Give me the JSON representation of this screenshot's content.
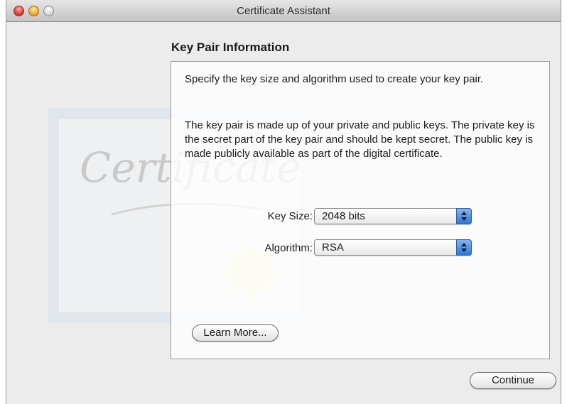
{
  "window": {
    "title": "Certificate Assistant"
  },
  "watermark": {
    "text": "Certificate"
  },
  "page": {
    "heading": "Key Pair Information",
    "description_1": "Specify the key size and algorithm used to create your key pair.",
    "description_2": "The key pair is made up of your private and public keys. The private key is the secret part of the key pair and should be kept secret. The public key is made publicly available as part of the digital certificate."
  },
  "form": {
    "key_size": {
      "label": "Key Size:",
      "value": "2048 bits"
    },
    "algorithm": {
      "label": "Algorithm:",
      "value": "RSA"
    }
  },
  "buttons": {
    "learn_more": "Learn More...",
    "continue": "Continue"
  },
  "colors": {
    "popup_accent": "#2f77d8",
    "window_bg": "#ececec"
  },
  "icons": [
    "close-icon",
    "minimize-icon",
    "zoom-icon",
    "popup-arrows-icon"
  ]
}
